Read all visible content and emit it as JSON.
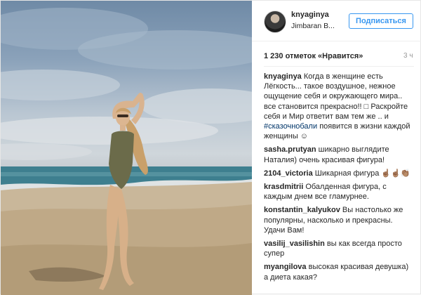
{
  "post": {
    "author": "knyaginya",
    "location": "Jimbaran B...",
    "follow_label": "Подписаться",
    "likes": "1 230 отметок «Нравится»",
    "time": "3 ч"
  },
  "comments": [
    {
      "author": "knyaginya",
      "text_a": "Когда в женщине есть Лёгкость... такое воздушное, нежное ощущение себя и окружающего мира.. все становится прекрасно!! □ Раскройте себя и Мир ответит вам тем же .. и",
      "hashtag": "#сказочнобали",
      "text_b": "появится в жизни каждой женщины ☺"
    },
    {
      "author": "sasha.prutyan",
      "text_a": "шикарно выглядите Наталия) очень красивая фигура!"
    },
    {
      "author": "2104_victoria",
      "text_a": "Шикарная фигура ☝🏽☝🏽👏🏽"
    },
    {
      "author": "krasdmitrii",
      "text_a": "Обалденная фигура, с каждым днем все гламурнее."
    },
    {
      "author": "konstantin_kalyukov",
      "text_a": "Вы настолько же популярны, насколько и прекрасны. Удачи Вам!"
    },
    {
      "author": "vasilij_vasilishin",
      "text_a": "вы как всегда просто супер"
    },
    {
      "author": "myangilova",
      "text_a": "высокая красивая девушка) а диета какая?"
    }
  ]
}
